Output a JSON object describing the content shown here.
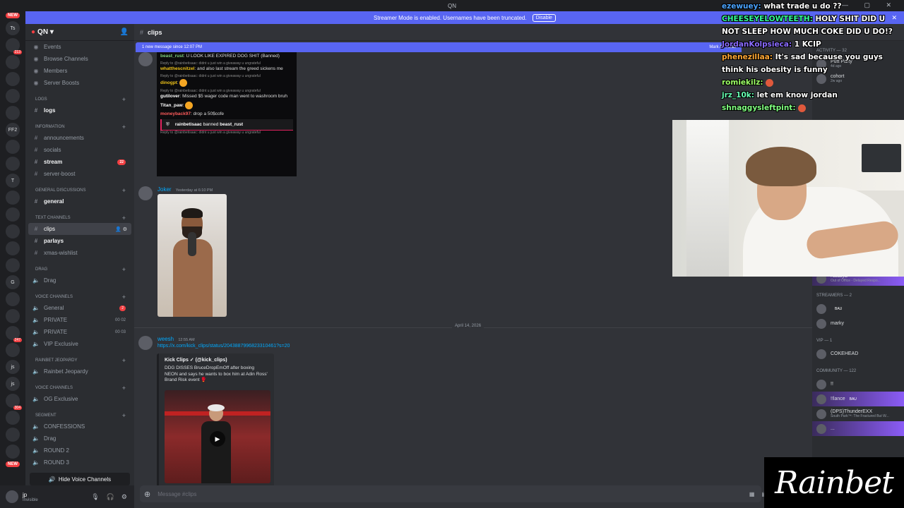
{
  "titlebar": {
    "title": "QN",
    "controls": "— ▢ ✕"
  },
  "banner": {
    "text": "Streamer Mode is enabled. Usernames have been truncated.",
    "button": "Disable"
  },
  "rail": {
    "new_top": "NEW",
    "new_bottom": "NEW",
    "servers": [
      {
        "label": "Ts",
        "badge": ""
      },
      {
        "label": "",
        "badge": "213"
      },
      {
        "label": "",
        "badge": ""
      },
      {
        "label": "",
        "badge": ""
      },
      {
        "label": "",
        "badge": ""
      },
      {
        "label": "",
        "badge": ""
      },
      {
        "label": "FF2",
        "badge": ""
      },
      {
        "label": "",
        "badge": ""
      },
      {
        "label": "",
        "badge": ""
      },
      {
        "label": "T",
        "badge": ""
      },
      {
        "label": "",
        "badge": ""
      },
      {
        "label": "",
        "badge": ""
      },
      {
        "label": "",
        "badge": ""
      },
      {
        "label": "",
        "badge": ""
      },
      {
        "label": "",
        "badge": ""
      },
      {
        "label": "G",
        "badge": ""
      },
      {
        "label": "",
        "badge": ""
      },
      {
        "label": "",
        "badge": ""
      },
      {
        "label": "",
        "badge": "247"
      },
      {
        "label": "",
        "badge": ""
      },
      {
        "label": "js",
        "badge": ""
      },
      {
        "label": "js",
        "badge": ""
      },
      {
        "label": "",
        "badge": "304"
      },
      {
        "label": "",
        "badge": ""
      },
      {
        "label": "",
        "badge": ""
      },
      {
        "label": "",
        "badge": ""
      }
    ]
  },
  "sidebar": {
    "server_name": "QN",
    "top_items": [
      "Events",
      "Browse Channels",
      "Members",
      "Server Boosts"
    ],
    "categories": [
      {
        "name": "LOGS",
        "channels": [
          {
            "name": "logs",
            "icon": "#",
            "bright": true
          }
        ]
      },
      {
        "name": "INFORMATION",
        "channels": [
          {
            "name": "announcements",
            "icon": "#"
          },
          {
            "name": "socials",
            "icon": "#"
          },
          {
            "name": "stream",
            "icon": "#",
            "bright": true,
            "badge": "22"
          },
          {
            "name": "server-boost",
            "icon": "#"
          }
        ]
      },
      {
        "name": "GENERAL DISCUSSIONS",
        "channels": [
          {
            "name": "general",
            "icon": "#",
            "bright": true
          }
        ]
      },
      {
        "name": "TEXT CHANNELS",
        "channels": [
          {
            "name": "clips",
            "icon": "#",
            "selected": true
          },
          {
            "name": "parlays",
            "icon": "#",
            "bright": true
          },
          {
            "name": "xmas-wishlist",
            "icon": "#"
          }
        ]
      },
      {
        "name": "Drag",
        "channels": [
          {
            "name": "Drag",
            "icon": "🔊"
          }
        ]
      },
      {
        "name": "Voice Channels",
        "channels": [
          {
            "name": "General",
            "icon": "🔊",
            "badge": "2"
          },
          {
            "name": "PRIVATE",
            "icon": "🔊",
            "count": "00 02"
          },
          {
            "name": "PRIVATE",
            "icon": "🔊",
            "count": "00 03"
          },
          {
            "name": "VIP Exclusive",
            "icon": "🔊"
          }
        ]
      },
      {
        "name": "Rainbet Jeopardy",
        "channels": [
          {
            "name": "Rainbet Jeopardy",
            "icon": "🔊"
          }
        ]
      },
      {
        "name": "Voice Channels",
        "channels": [
          {
            "name": "OG Exclusive",
            "icon": "🔊"
          }
        ]
      },
      {
        "name": "Segment",
        "channels": [
          {
            "name": "CONFESSIONS",
            "icon": "🔊"
          },
          {
            "name": "Drag",
            "icon": "🔊"
          },
          {
            "name": "ROUND 2",
            "icon": "🔊"
          },
          {
            "name": "ROUND 3",
            "icon": "🔊"
          }
        ]
      }
    ],
    "hide_voice": "Hide Voice Channels"
  },
  "user": {
    "name": "jp",
    "status": "Invisible"
  },
  "chat": {
    "channel": "clips",
    "new_messages": "1 new message since 12:07 PM",
    "mark_read": "Mark As Read",
    "shot": {
      "lines": [
        {
          "user": "beast_rust",
          "text": "U LOOK LIKE EXPIRED DOG SHIT (Banned)",
          "reply": ""
        },
        {
          "user": "",
          "text": "",
          "reply": "Reply to @rainbetisaac: didnt u just win a giveaway u ungrateful"
        },
        {
          "user": "whatthescnitzel",
          "text": "and also last stream the greed sickens me",
          "reply": ""
        },
        {
          "user": "",
          "text": "",
          "reply": "Reply to @rainbetisaac: didnt u just win a giveaway u ungrateful"
        },
        {
          "user": "dinogpt",
          "text": "",
          "reply": ""
        },
        {
          "user": "",
          "text": "",
          "reply": "Reply to @rainbetisaac: didnt u just win a giveaway u ungrateful"
        },
        {
          "user": "gutilover",
          "text": "Missed $5 wager code man went to washroom bruh",
          "reply": ""
        },
        {
          "user": "Titan_paw",
          "text": "",
          "reply": ""
        },
        {
          "user": "moneyback97",
          "text": "drop a 50$cofe",
          "reply": ""
        }
      ],
      "ban_actor": "rainbetisaac",
      "ban_verb": "banned",
      "ban_target": "beast_rust",
      "last_reply": "Reply to @rainbetisaac: didnt u just win a giveaway u ungrateful"
    },
    "joker_name": "Joker",
    "joker_time": "Yesterday at 6:10 PM",
    "date_sep": "April 14, 2026",
    "weesh_name": "weesh",
    "weesh_time": "12:55 AM",
    "weesh_link": "https://x.com/kick_clips/status/2043887996823310461?s=20",
    "embed_author": "Kick Clips ✓ (@kick_clips)",
    "embed_desc": "DDG DISSES BruceDropEmOff after boxing NEON and says he wants to box him at Adin Ross' Brand Risk event 🥊",
    "composer_placeholder": "Message #clips"
  },
  "overlay": {
    "lines": [
      {
        "user": "ezewuey:",
        "text": "what trade u do ??",
        "color": "#4aa3ff"
      },
      {
        "user": "CHEESEYELOWTEETH:",
        "text": "HOLY SHIT DID U NOT SLEEP HOW MUCH COKE DID U DO!?",
        "color": "#33ff99"
      },
      {
        "user": "JordanKolpsieca:",
        "text": "1 KCIP",
        "color": "#8a6bff"
      },
      {
        "user": "phenezillaa:",
        "text": "It's sad because you guys think his obesity is funny",
        "color": "#ffa733"
      },
      {
        "user": "romiekilz:",
        "text": "",
        "color": "#9cff66"
      },
      {
        "user": "jrz_10k:",
        "text": "let em know jordan",
        "color": "#66ffb3"
      },
      {
        "user": "shnaggysleftpint:",
        "text": "",
        "color": "#80ff80"
      }
    ]
  },
  "members": {
    "activity_title": "Activity — 32",
    "activity_items": [
      {
        "name": "Putt Party",
        "sub": "4d ago"
      },
      {
        "name": "cohort",
        "sub": "2w ago"
      }
    ],
    "groups": [
      {
        "title": "Nat — 1",
        "people": [
          {
            "name": "Natalya",
            "sub": "Out of Office - Delayed Respo...",
            "highlight": true
          }
        ]
      },
      {
        "title": "Streamers — 2",
        "people": [
          {
            "name": "",
            "tag": "BAU"
          },
          {
            "name": "marky"
          }
        ]
      },
      {
        "title": "VIP — 1",
        "people": [
          {
            "name": "COKEHEAD"
          }
        ]
      },
      {
        "title": "Community — 122",
        "people": [
          {
            "name": "!!"
          },
          {
            "name": "!!lance",
            "tag": "BAU",
            "highlight": true
          },
          {
            "name": "(DPS)ThunderEXX",
            "sub": "South Park™: The Fractured But W..."
          },
          {
            "name": "...",
            "highlight": true
          }
        ]
      }
    ]
  },
  "logo": {
    "text": "Rainbet"
  }
}
